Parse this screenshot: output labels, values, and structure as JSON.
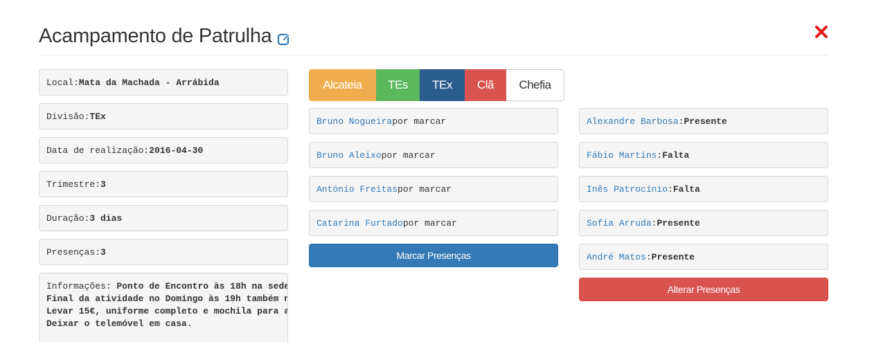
{
  "header": {
    "title": "Acampamento de Patrulha"
  },
  "details": {
    "local_label": "Local: ",
    "local_value": "Mata da Machada - Arrábida",
    "divisao_label": "Divisão: ",
    "divisao_value": "TEx",
    "data_label": "Data de realização: ",
    "data_value": "2016-04-30",
    "trimestre_label": "Trimestre: ",
    "trimestre_value": "3",
    "duracao_label": "Duração: ",
    "duracao_value": "3 dias",
    "presencas_label": "Presenças: ",
    "presencas_value": "3",
    "info_label": "Informações: ",
    "info_line1": "Ponto de Encontro às 18h na sede",
    "info_line2": "Final da atividade no Domingo às 19h também n",
    "info_line3": "Levar 15€, uniforme completo e mochila para a",
    "info_line4": "Deixar o telemóvel em casa."
  },
  "tabs": [
    "Alcateia",
    "TEs",
    "TEx",
    "Clã",
    "Chefia"
  ],
  "pending": {
    "status_text": " por marcar",
    "names": [
      "Bruno Nogueira",
      "Bruno Aleixo",
      "António Freitas",
      "Catarina Furtado"
    ],
    "button_label": "Marcar Presenças"
  },
  "marked": {
    "rows": [
      {
        "name": "Alexandre Barbosa",
        "sep": ": ",
        "status": "Presente"
      },
      {
        "name": "Fábio Martins",
        "sep": ": ",
        "status": "Falta"
      },
      {
        "name": "Inês Patrocínio",
        "sep": ": ",
        "status": "Falta"
      },
      {
        "name": "Sofia Arruda",
        "sep": ": ",
        "status": "Presente"
      },
      {
        "name": "André Matos",
        "sep": ": ",
        "status": "Presente"
      }
    ],
    "button_label": "Alterar Presenças"
  },
  "colors": {
    "link": "#337ab7",
    "primary": "#337ab7",
    "danger": "#d9534f",
    "warning": "#f0ad4e",
    "success": "#5cb85c",
    "tex": "#2a5d8d"
  }
}
